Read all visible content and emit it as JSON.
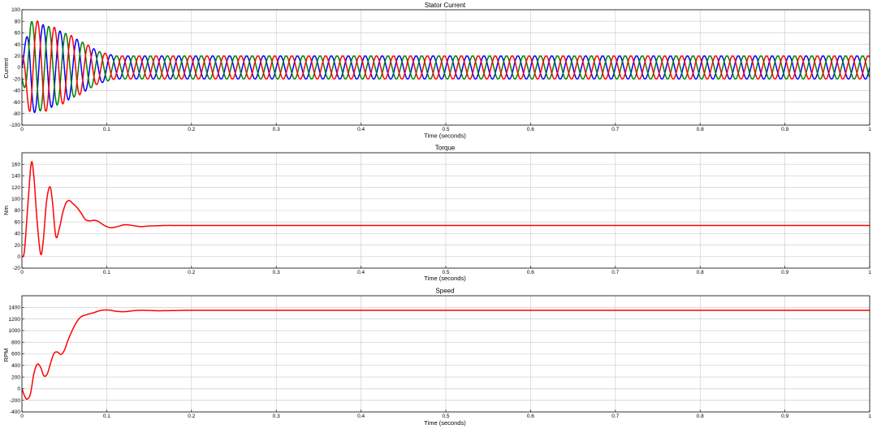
{
  "chart_data": [
    {
      "type": "line",
      "title": "Stator Current",
      "xlabel": "Time (seconds)",
      "ylabel": "Current",
      "xlim": [
        0,
        1
      ],
      "ylim": [
        -100,
        100
      ],
      "xticks": [
        0,
        0.1,
        0.2,
        0.3,
        0.4,
        0.5,
        0.6,
        0.7,
        0.8,
        0.9,
        1
      ],
      "xtick_labels": [
        "0",
        "0.1",
        "0.2",
        "0.3",
        "0.4",
        "0.5",
        "0.6",
        "0.7",
        "0.8",
        "0.9",
        "1"
      ],
      "yticks": [
        -100,
        -80,
        -60,
        -40,
        -20,
        0,
        20,
        40,
        60,
        80,
        100
      ],
      "ytick_labels": [
        "-100",
        "-80",
        "-60",
        "-40",
        "-20",
        "0",
        "20",
        "40",
        "60",
        "80",
        "100"
      ],
      "grid": true,
      "series": [
        {
          "color": "#0000ff",
          "signal": "sinusoid",
          "frequency_hz": 50,
          "phase_deg": 0,
          "steady_amplitude": 20,
          "envelope": {
            "t": [
              0,
              0.01,
              0.03,
              0.05,
              0.07,
              0.09,
              0.11,
              1
            ],
            "amp": [
              20,
              80,
              72,
              60,
              45,
              28,
              20,
              20
            ]
          }
        },
        {
          "color": "#008000",
          "signal": "sinusoid",
          "frequency_hz": 50,
          "phase_deg": -120,
          "steady_amplitude": 20,
          "envelope": {
            "t": [
              0,
              0.01,
              0.03,
              0.05,
              0.07,
              0.09,
              0.11,
              1
            ],
            "amp": [
              20,
              80,
              72,
              60,
              45,
              28,
              20,
              20
            ]
          }
        },
        {
          "color": "#ff0000",
          "signal": "sinusoid",
          "frequency_hz": 50,
          "phase_deg": 120,
          "steady_amplitude": 20,
          "envelope": {
            "t": [
              0,
              0.01,
              0.03,
              0.05,
              0.07,
              0.09,
              0.11,
              1
            ],
            "amp": [
              20,
              84,
              75,
              62,
              46,
              28,
              20,
              20
            ]
          }
        }
      ]
    },
    {
      "type": "line",
      "title": "Torque",
      "xlabel": "Time (seconds)",
      "ylabel": "Nm",
      "xlim": [
        0,
        1
      ],
      "ylim": [
        -20,
        180
      ],
      "xticks": [
        0,
        0.1,
        0.2,
        0.3,
        0.4,
        0.5,
        0.6,
        0.7,
        0.8,
        0.9,
        1
      ],
      "xtick_labels": [
        "0",
        "0.1",
        "0.2",
        "0.3",
        "0.4",
        "0.5",
        "0.6",
        "0.7",
        "0.8",
        "0.9",
        "1"
      ],
      "yticks": [
        -20,
        0,
        20,
        40,
        60,
        80,
        100,
        120,
        140,
        160
      ],
      "ytick_labels": [
        "-20",
        "0",
        "20",
        "40",
        "60",
        "80",
        "100",
        "120",
        "140",
        "160"
      ],
      "grid": true,
      "series": [
        {
          "color": "#ff0000",
          "x": [
            0,
            0.003,
            0.007,
            0.011,
            0.014,
            0.018,
            0.022,
            0.025,
            0.029,
            0.033,
            0.036,
            0.04,
            0.044,
            0.048,
            0.052,
            0.056,
            0.06,
            0.065,
            0.07,
            0.075,
            0.08,
            0.085,
            0.09,
            0.095,
            0.1,
            0.105,
            0.11,
            0.115,
            0.12,
            0.125,
            0.13,
            0.14,
            0.15,
            0.16,
            0.17,
            0.18,
            0.2,
            0.25,
            0.3,
            0.4,
            0.5,
            0.6,
            0.7,
            0.8,
            0.9,
            1
          ],
          "y": [
            0,
            10,
            90,
            162,
            140,
            60,
            5,
            25,
            95,
            121,
            95,
            35,
            48,
            75,
            93,
            97,
            92,
            85,
            75,
            64,
            62,
            63,
            61,
            56,
            52,
            50,
            51,
            53,
            55,
            55,
            54,
            52,
            53,
            53.5,
            54,
            54,
            54,
            54,
            54,
            54,
            54,
            54,
            54,
            54,
            54,
            54
          ]
        }
      ]
    },
    {
      "type": "line",
      "title": "Speed",
      "xlabel": "Time (seconds)",
      "ylabel": "RPM",
      "xlim": [
        0,
        1
      ],
      "ylim": [
        -400,
        1600
      ],
      "xticks": [
        0,
        0.1,
        0.2,
        0.3,
        0.4,
        0.5,
        0.6,
        0.7,
        0.8,
        0.9,
        1
      ],
      "xtick_labels": [
        "0",
        "0.1",
        "0.2",
        "0.3",
        "0.4",
        "0.5",
        "0.6",
        "0.7",
        "0.8",
        "0.9",
        "1"
      ],
      "yticks": [
        -400,
        -200,
        0,
        200,
        400,
        600,
        800,
        1000,
        1200,
        1400
      ],
      "ytick_labels": [
        "-400",
        "-200",
        "0",
        "200",
        "400",
        "600",
        "800",
        "1000",
        "1200",
        "1400"
      ],
      "grid": true,
      "series": [
        {
          "color": "#ff0000",
          "x": [
            0,
            0.003,
            0.006,
            0.01,
            0.014,
            0.018,
            0.022,
            0.026,
            0.03,
            0.034,
            0.038,
            0.042,
            0.046,
            0.05,
            0.054,
            0.058,
            0.062,
            0.066,
            0.07,
            0.075,
            0.08,
            0.085,
            0.09,
            0.095,
            0.1,
            0.105,
            0.11,
            0.12,
            0.13,
            0.14,
            0.15,
            0.16,
            0.18,
            0.2,
            0.3,
            0.4,
            0.5,
            0.6,
            0.7,
            0.8,
            0.9,
            1
          ],
          "y": [
            0,
            -120,
            -180,
            -90,
            250,
            420,
            370,
            220,
            260,
            450,
            610,
            630,
            590,
            660,
            820,
            960,
            1080,
            1180,
            1240,
            1270,
            1290,
            1310,
            1335,
            1352,
            1355,
            1350,
            1335,
            1325,
            1340,
            1350,
            1347,
            1342,
            1345,
            1350,
            1350,
            1350,
            1350,
            1350,
            1350,
            1350,
            1350,
            1350
          ]
        }
      ]
    }
  ]
}
